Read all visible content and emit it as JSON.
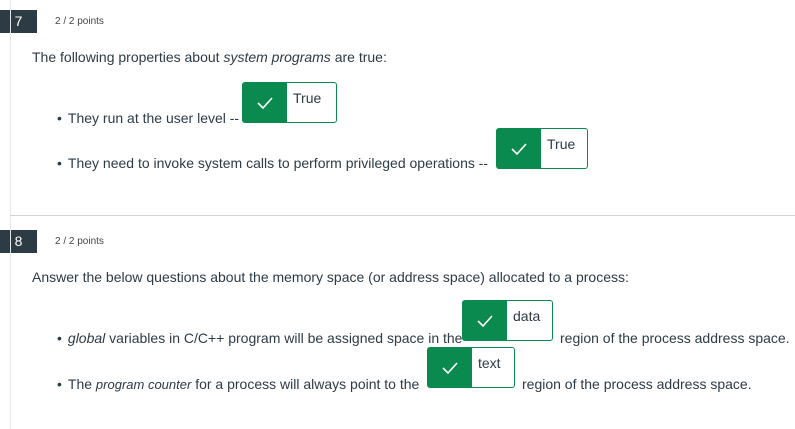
{
  "q7": {
    "number": "7",
    "points": "2 / 2 points",
    "prompt_pre": "The following properties about ",
    "prompt_em": "system programs",
    "prompt_post": " are true:",
    "items": [
      {
        "text": "They run at the user level --",
        "answer": "True"
      },
      {
        "text": "They need to invoke system calls to perform privileged operations --",
        "answer": "True"
      }
    ]
  },
  "q8": {
    "number": "8",
    "points": "2 / 2 points",
    "prompt": "Answer the below questions about the memory space (or address space) allocated to a process:",
    "item1": {
      "em": "global",
      "pre": " variables in C/C++ program will be assigned space in the",
      "answer": "data",
      "post": "region of the process address space."
    },
    "item2": {
      "pre": "The ",
      "em": "program counter",
      "mid": " for a process will always point to the",
      "answer": "text",
      "post": "region of the process address space."
    }
  },
  "colors": {
    "correct": "#0a8a4f",
    "badge": "#2d3b45"
  }
}
